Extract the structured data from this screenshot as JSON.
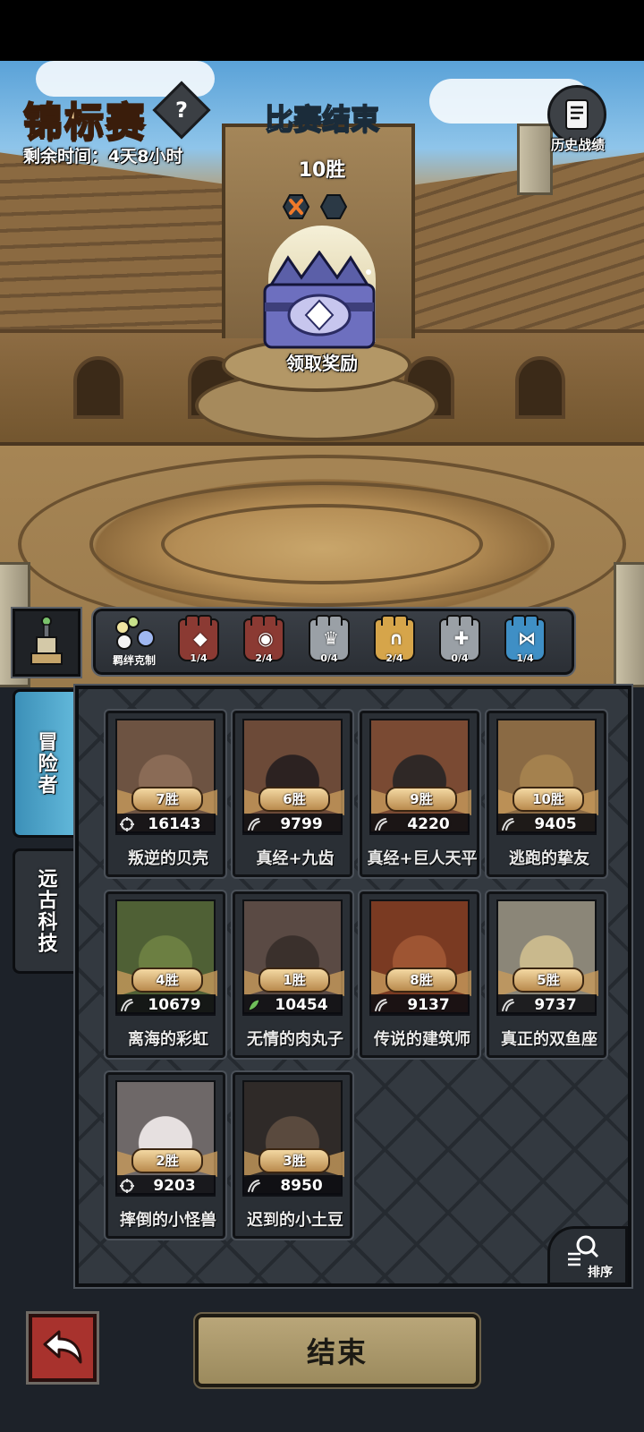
{
  "header": {
    "title": "锦标赛",
    "help_icon": "question-icon",
    "remaining_time": "剩余时间：4天8小时",
    "status": "比赛结束",
    "wins": "10胜",
    "history_label": "历史战绩",
    "history_icon": "scroll-icon"
  },
  "reward": {
    "claim_label": "领取奖励",
    "chest_icon": "treasure-chest-icon"
  },
  "bonds": {
    "first_label": "羁绊克制",
    "items": [
      {
        "count": "1/4",
        "color": "#8b3a33",
        "icon": "crystal-icon"
      },
      {
        "count": "2/4",
        "color": "#8b3a33",
        "icon": "eye-icon"
      },
      {
        "count": "0/4",
        "color": "#9aa0a6",
        "icon": "crown-spikes-icon"
      },
      {
        "count": "2/4",
        "color": "#d6a54a",
        "icon": "arch-icon"
      },
      {
        "count": "0/4",
        "color": "#9aa0a6",
        "icon": "shield-cross-icon"
      },
      {
        "count": "1/4",
        "color": "#3f8fc5",
        "icon": "bowtie-icon"
      }
    ]
  },
  "tabs": {
    "adventurer": "冒险者",
    "tech": "远古科技"
  },
  "heroes": [
    {
      "name": "叛逆的贝壳",
      "wins": "7胜",
      "power": "16143",
      "bg": "#6d5342",
      "fg": "#8a6b56",
      "power_icon": "target-icon"
    },
    {
      "name": "真经+九齿",
      "wins": "6胜",
      "power": "9799",
      "bg": "#6c4a38",
      "fg": "#2c2221",
      "power_icon": "claw-icon"
    },
    {
      "name": "真经+巨人天平",
      "wins": "9胜",
      "power": "4220",
      "bg": "#7a4a33",
      "fg": "#2f2826",
      "power_icon": "claw-icon"
    },
    {
      "name": "逃跑的挚友",
      "wins": "10胜",
      "power": "9405",
      "bg": "#8a6a44",
      "fg": "#a4814e",
      "power_icon": "claw-icon"
    },
    {
      "name": "离海的彩虹",
      "wins": "4胜",
      "power": "10679",
      "bg": "#4f6035",
      "fg": "#6c7f42",
      "power_icon": "claw-icon"
    },
    {
      "name": "无情的肉丸子",
      "wins": "1胜",
      "power": "10454",
      "bg": "#5a4a44",
      "fg": "#3a302c",
      "power_icon": "leaf-claw-icon"
    },
    {
      "name": "传说的建筑师",
      "wins": "8胜",
      "power": "9137",
      "bg": "#7a3a22",
      "fg": "#9e5533",
      "power_icon": "claw-icon"
    },
    {
      "name": "真正的双鱼座",
      "wins": "5胜",
      "power": "9737",
      "bg": "#8b8678",
      "fg": "#c9b98d",
      "power_icon": "claw-icon"
    },
    {
      "name": "摔倒的小怪兽",
      "wins": "2胜",
      "power": "9203",
      "bg": "#6e6868",
      "fg": "#e6e0e0",
      "power_icon": "target-icon"
    },
    {
      "name": "迟到的小土豆",
      "wins": "3胜",
      "power": "8950",
      "bg": "#2f2a28",
      "fg": "#5a4a3e",
      "power_icon": "claw-icon"
    }
  ],
  "footer": {
    "sort_label": "排序",
    "end_label": "结束",
    "back_icon": "back-arrow-icon"
  }
}
